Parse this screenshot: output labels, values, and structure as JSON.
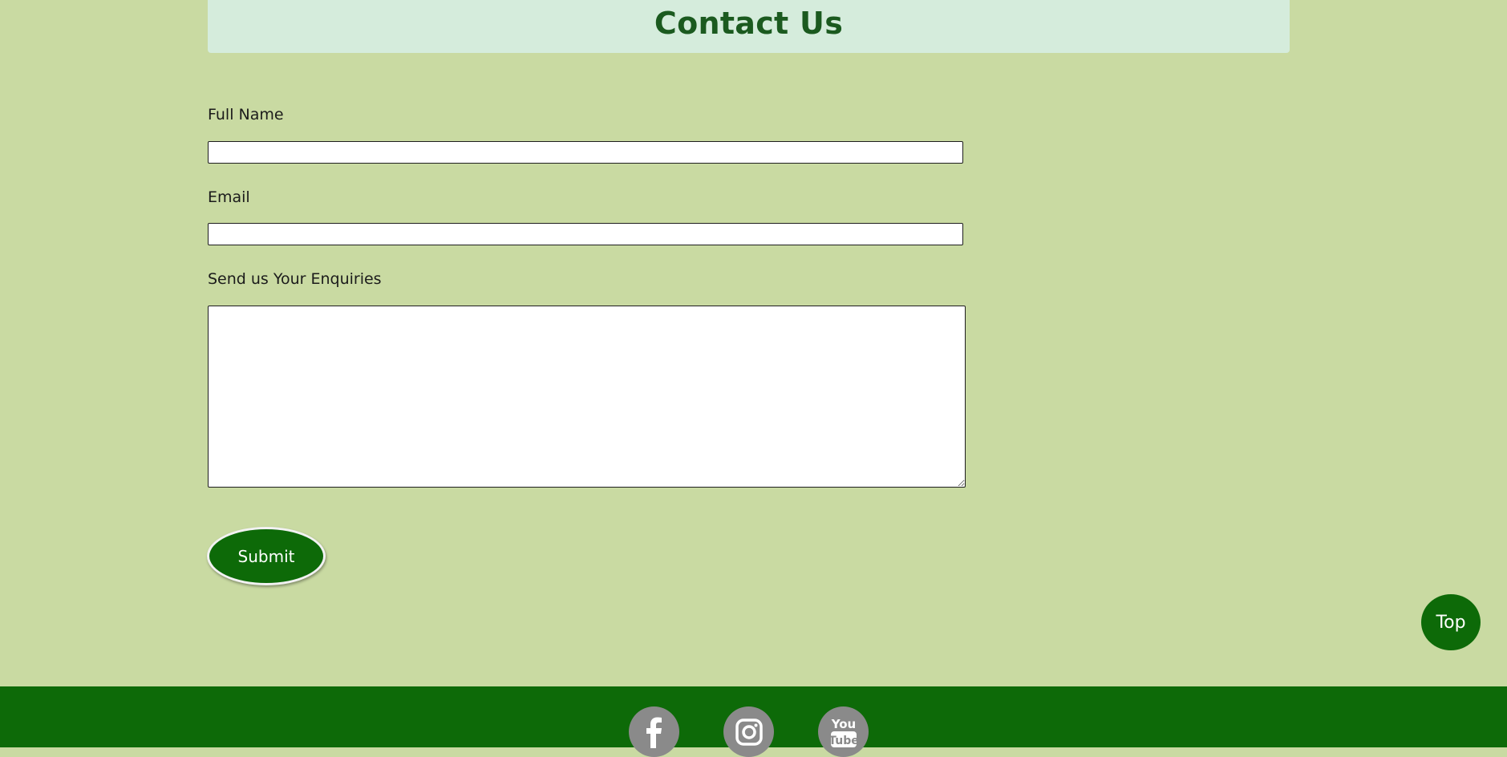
{
  "header": {
    "title": "Contact Us"
  },
  "form": {
    "fields": [
      {
        "label": "Full Name",
        "value": "",
        "placeholder": ""
      },
      {
        "label": "Email",
        "value": "",
        "placeholder": ""
      }
    ],
    "message": {
      "label": "Send us Your Enquiries",
      "value": ""
    },
    "submit_label": "Submit"
  },
  "top_button_label": "Top",
  "footer": {
    "social": [
      {
        "name": "facebook-icon"
      },
      {
        "name": "instagram-icon"
      },
      {
        "name": "youtube-icon",
        "text_top": "You",
        "text_bottom": "Tube"
      }
    ]
  },
  "colors": {
    "background": "#c9daa2",
    "header_box": "#d5ecdc",
    "title": "#1b5a1f",
    "brand_green": "#0d6a08",
    "icon_circle": "#8a8a8a"
  }
}
